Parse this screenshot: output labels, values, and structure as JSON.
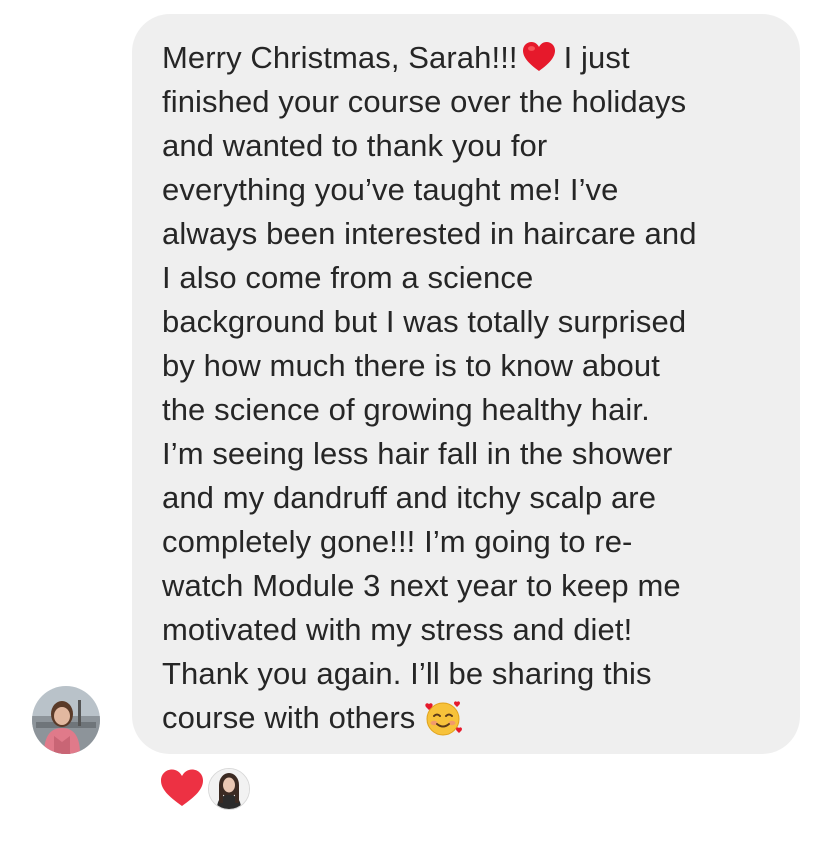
{
  "message": {
    "lines": [
      "Merry Christmas, Sarah!!!",
      "I just",
      "finished your course over the holidays",
      "and wanted to thank you for",
      "everything you’ve taught me! I’ve",
      "always been interested in haircare and",
      "I also come from a science",
      "background but I was totally surprised",
      "by how much there is to know about",
      "the science of growing healthy hair.",
      "I’m seeing less hair fall in the shower",
      "and my dandruff and itchy scalp are",
      "completely gone!!! I’m going to re-",
      "watch Module 3 next year to keep me",
      "motivated with my stress and diet!",
      "Thank you again. I’ll be sharing this",
      "course with others"
    ],
    "inline_emoji_1": "red-heart-emoji",
    "inline_emoji_2": "smiling-face-with-hearts-emoji"
  },
  "sender": {
    "avatar_icon": "user-avatar-photo"
  },
  "reactions": {
    "emoji": "red-heart-icon",
    "reactor_avatar_icon": "reactor-avatar-photo"
  },
  "colors": {
    "bubble_bg": "#efefef",
    "text": "#262626",
    "heart": "#ed4956"
  }
}
